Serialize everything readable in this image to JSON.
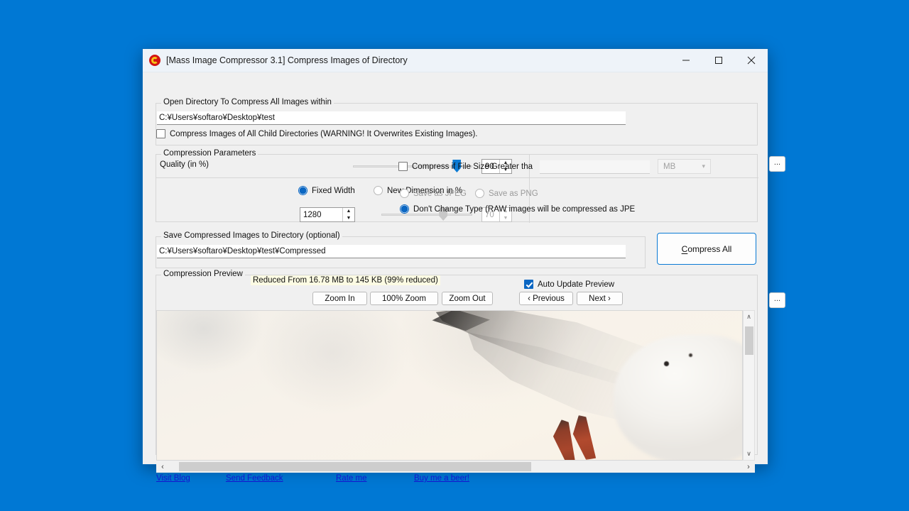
{
  "desktop": {
    "background": "#0078d4"
  },
  "window": {
    "title": "[Mass Image Compressor 3.1] Compress Images of Directory",
    "app_icon": "compressor-logo-icon",
    "controls": {
      "minimize": "minimize-icon",
      "maximize": "maximize-icon",
      "close": "close-icon"
    }
  },
  "open_directory": {
    "group_label": "Open Directory To Compress All Images within",
    "path_value": "C:¥Users¥softaro¥Desktop¥test",
    "path_placeholder": "",
    "browse_label": "...",
    "child_dirs_label": "Compress Images of All Child Directories (WARNING! It Overwrites Existing Images).",
    "child_dirs_checked": false
  },
  "compression_parameters": {
    "group_label": "Compression Parameters",
    "quality_label": "Quality (in %)",
    "quality_value": "90",
    "quality_percent": 90,
    "fixed_width_label": "Fixed Width",
    "fixed_width_selected": true,
    "new_dimension_label": "New Dimension in %",
    "new_dimension_selected": false,
    "fixed_width_value": "1280",
    "dimension_value": "70",
    "dimension_percent": 70,
    "filesize_label": "Compress if File Size Greater tha",
    "filesize_checked": false,
    "filesize_value": "",
    "unit_selected": "MB",
    "save_jpeg_label": "Save as JPEG",
    "save_jpeg_selected": false,
    "save_png_label": "Save as PNG",
    "save_png_selected": false,
    "dont_change_label": "Don't Change Type (RAW images will be compressed as JPE",
    "dont_change_selected": true
  },
  "save_directory": {
    "group_label": "Save Compressed Images to Directory (optional)",
    "path_value": "C:¥Users¥softaro¥Desktop¥test¥Compressed",
    "browse_label": "..."
  },
  "compress_all": {
    "label_prefix": "C",
    "label_rest": "ompress All",
    "accent": "#0a7ad4"
  },
  "preview": {
    "group_label": "Compression Preview",
    "stats": "Reduced From 16.78 MB to 145 KB (99% reduced)",
    "stats_background": "#fcfbe3",
    "auto_update_label": "Auto Update Preview",
    "auto_update_checked": true,
    "buttons": {
      "zoom_in": "Zoom In",
      "zoom_100": "100% Zoom",
      "zoom_out": "Zoom Out",
      "previous": "‹ Previous",
      "next": "Next ›"
    },
    "image_alt": "seagull-wing-preview",
    "vscroll_up": "∧",
    "vscroll_down": "∨",
    "hscroll_left": "‹",
    "hscroll_right": "›"
  },
  "footer_links": [
    {
      "label": "Visit Blog",
      "name": "visit-blog-link"
    },
    {
      "label": "Send Feedback",
      "name": "send-feedback-link"
    },
    {
      "label": "Rate me",
      "name": "rate-me-link"
    },
    {
      "label": "Buy me a beer!",
      "name": "buy-me-a-beer-link"
    }
  ]
}
